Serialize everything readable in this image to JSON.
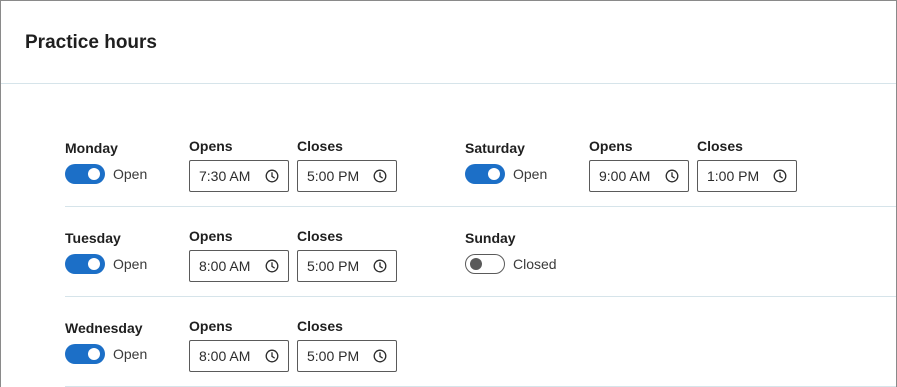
{
  "title": "Practice hours",
  "labels": {
    "opens": "Opens",
    "closes": "Closes"
  },
  "colors": {
    "accent": "#1c6fc7",
    "divider": "#d6e4ea",
    "toggle_off": "#5a5a5a"
  },
  "days": [
    {
      "name": "Monday",
      "status": "Open",
      "open": true,
      "opens": "7:30 AM",
      "closes": "5:00 PM"
    },
    {
      "name": "Tuesday",
      "status": "Open",
      "open": true,
      "opens": "8:00 AM",
      "closes": "5:00 PM"
    },
    {
      "name": "Wednesday",
      "status": "Open",
      "open": true,
      "opens": "8:00 AM",
      "closes": "5:00 PM"
    },
    {
      "name": "Saturday",
      "status": "Open",
      "open": true,
      "opens": "9:00 AM",
      "closes": "1:00 PM"
    },
    {
      "name": "Sunday",
      "status": "Closed",
      "open": false,
      "opens": "",
      "closes": ""
    }
  ],
  "icons": {
    "time": "clock-icon"
  }
}
